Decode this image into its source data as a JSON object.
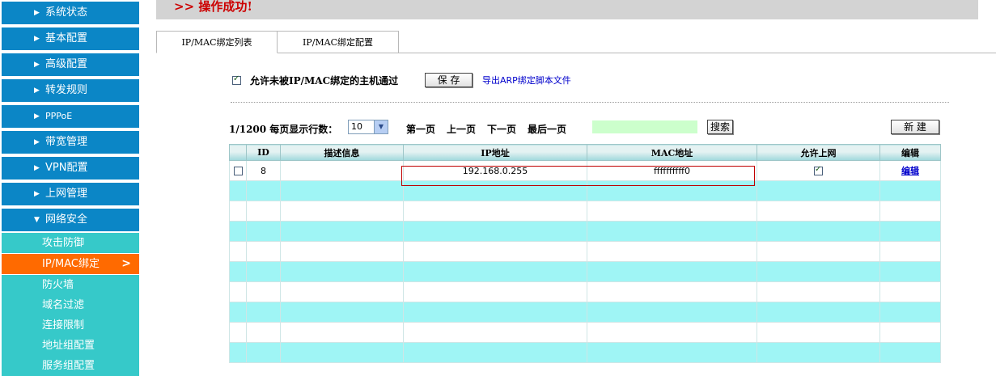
{
  "header": {
    "message": ">>  操作成功!"
  },
  "sidebar": {
    "menu": [
      {
        "label": "系统状态"
      },
      {
        "label": "基本配置"
      },
      {
        "label": "高级配置"
      },
      {
        "label": "转发规则"
      },
      {
        "label": "PPPoE"
      },
      {
        "label": "带宽管理"
      },
      {
        "label": "VPN配置"
      },
      {
        "label": "上网管理"
      },
      {
        "label": "网络安全"
      }
    ],
    "submenu": [
      {
        "label": "攻击防御"
      },
      {
        "label": "IP/MAC绑定"
      },
      {
        "label": "防火墙"
      },
      {
        "label": "域名过滤"
      },
      {
        "label": "连接限制"
      },
      {
        "label": "地址组配置"
      },
      {
        "label": "服务组配置"
      }
    ],
    "active_color": "#ff6a00",
    "menu_color": "#0b86c6",
    "sub_color": "#36c9c9"
  },
  "tabs": [
    {
      "label": "IP/MAC绑定列表"
    },
    {
      "label": "IP/MAC绑定配置"
    }
  ],
  "options": {
    "allow_label": "允许未被IP/MAC绑定的主机通过",
    "allow_checked": true,
    "save_label": "保 存",
    "export_label": "导出ARP绑定脚本文件"
  },
  "pager": {
    "info": "1/1200  每页显示行数：",
    "rows_per_page": "10",
    "first": "第一页",
    "prev": "上一页",
    "next": "下一页",
    "last": "最后一页",
    "search_label": "搜索",
    "new_label": "新 建"
  },
  "table": {
    "columns": [
      "",
      "ID",
      "描述信息",
      "IP地址",
      "MAC地址",
      "允许上网",
      "编辑"
    ],
    "rows": [
      {
        "id": "8",
        "desc": "",
        "ip": "192.168.0.255",
        "mac": "ffffffffff0",
        "allowed": true,
        "edit": "编辑"
      }
    ]
  }
}
